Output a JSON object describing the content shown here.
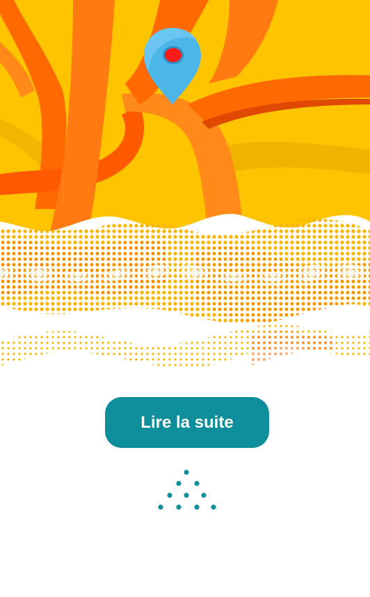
{
  "hero": {
    "image_icon": "map-pin-icon",
    "colors": {
      "background": "#ffc400",
      "ribbon": "#ff6a00",
      "ribbon_light": "#ff8a1a",
      "ribbon_shadow": "#e04a00",
      "pin": "#4db6e8",
      "pin_hole": "#ff1a1a",
      "halftone": "#f7b500"
    }
  },
  "cta": {
    "label": "Lire la suite",
    "color": "#0e8d9b",
    "text_color": "#ffffff"
  },
  "decoration": {
    "icon": "dot-triangle-icon",
    "color": "#0e8d9b"
  }
}
